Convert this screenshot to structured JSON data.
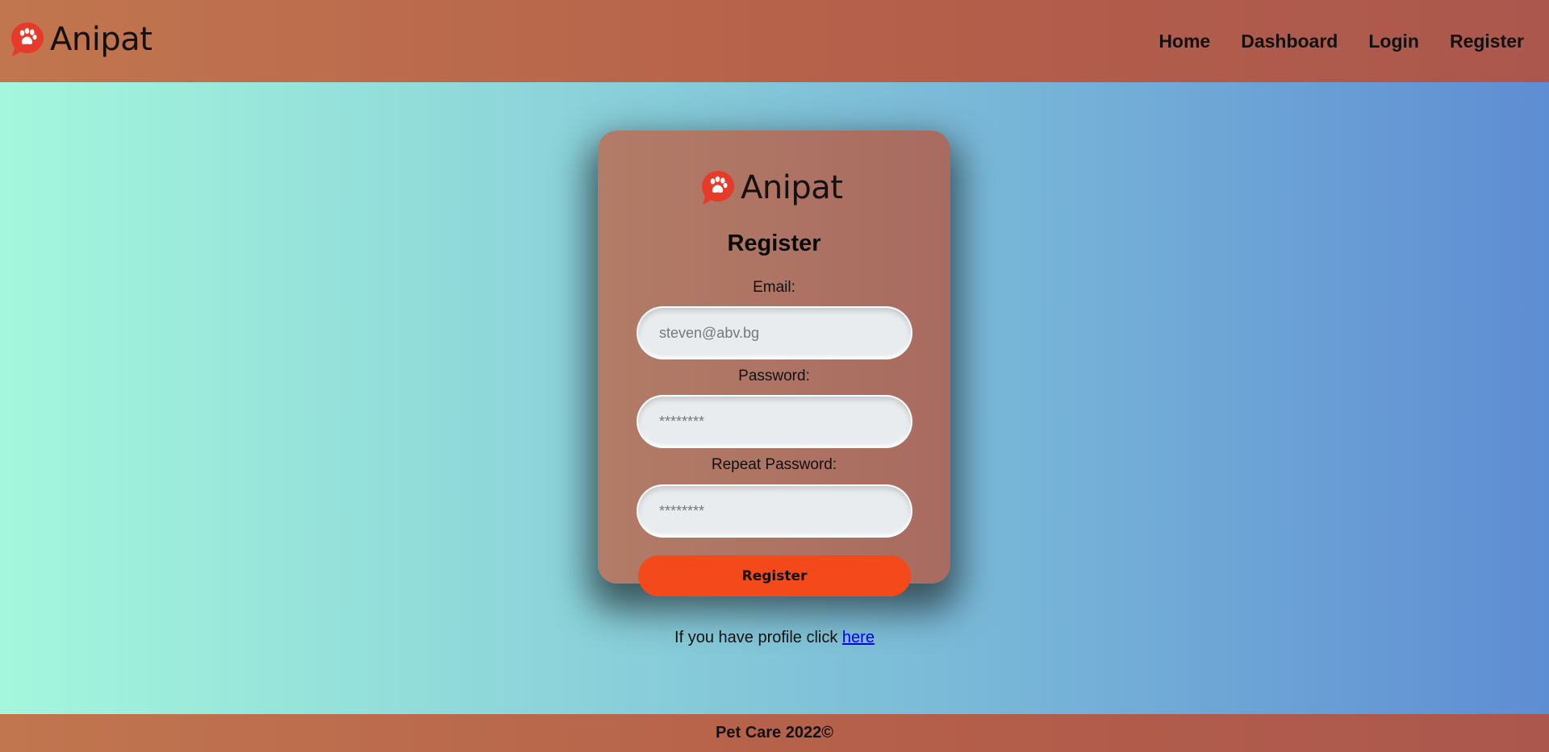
{
  "header": {
    "brand": "Anipat",
    "nav": [
      {
        "label": "Home"
      },
      {
        "label": "Dashboard"
      },
      {
        "label": "Login"
      },
      {
        "label": "Register"
      }
    ]
  },
  "form": {
    "brand": "Anipat",
    "title": "Register",
    "email_label": "Email:",
    "email_placeholder": "steven@abv.bg",
    "password_label": "Password:",
    "password_placeholder": "********",
    "repeat_password_label": "Repeat Password:",
    "repeat_password_placeholder": "********",
    "submit_label": "Register"
  },
  "login_hint": {
    "text": "If you have profile click ",
    "link": "here"
  },
  "footer": {
    "text": "Pet Care 2022©"
  },
  "icons": {
    "logo": "paw-speech-bubble-icon"
  },
  "colors": {
    "accent": "#f44a1b",
    "logo_red": "#e63a2a",
    "header_bg_start": "#c1764f",
    "header_bg_end": "#ab574d",
    "page_bg_start": "#a4f7dc",
    "page_bg_end": "#5e8dd3"
  }
}
